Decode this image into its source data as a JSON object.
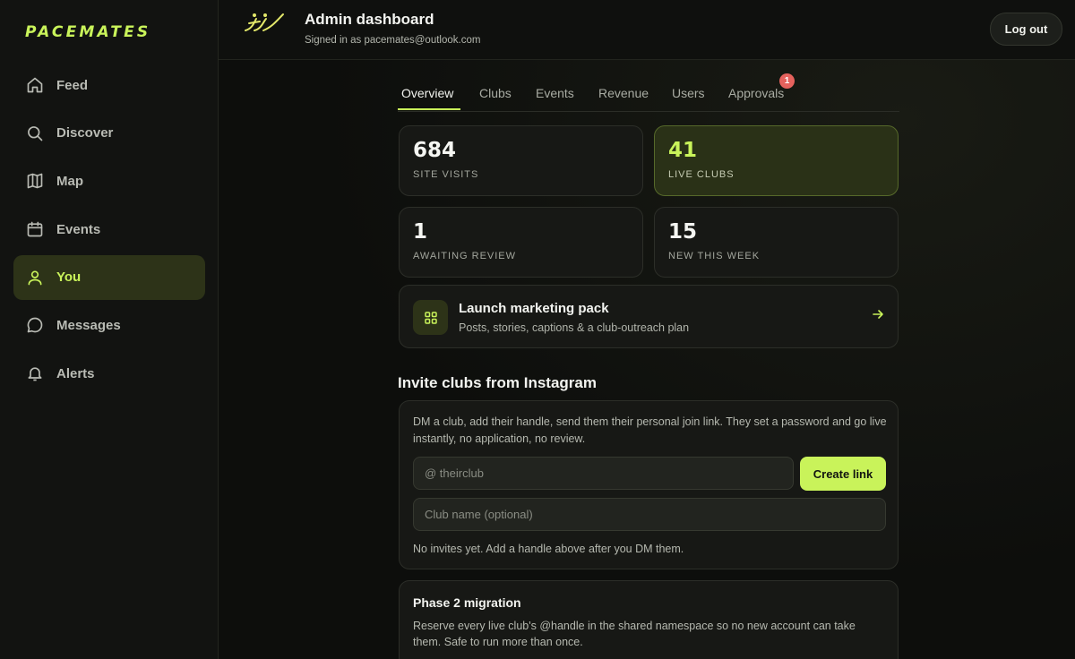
{
  "brand": "PACEMATES",
  "sidebar": {
    "items": [
      {
        "label": "Feed",
        "icon": "home-icon"
      },
      {
        "label": "Discover",
        "icon": "search-icon"
      },
      {
        "label": "Map",
        "icon": "map-icon"
      },
      {
        "label": "Events",
        "icon": "calendar-icon"
      },
      {
        "label": "You",
        "icon": "user-icon",
        "active": true
      },
      {
        "label": "Messages",
        "icon": "chat-icon"
      },
      {
        "label": "Alerts",
        "icon": "bell-icon"
      }
    ]
  },
  "header": {
    "title": "Admin dashboard",
    "subtitle": "Signed in as pacemates@outlook.com",
    "logout_label": "Log out"
  },
  "tabs": {
    "items": [
      "Overview",
      "Clubs",
      "Events",
      "Revenue",
      "Users",
      "Approvals"
    ],
    "active": "Overview",
    "approvals_badge": "1"
  },
  "stats": {
    "site_visits": {
      "value": "684",
      "label": "SITE VISITS"
    },
    "live_clubs": {
      "value": "41",
      "label": "LIVE CLUBS"
    },
    "awaiting_review": {
      "value": "1",
      "label": "AWAITING REVIEW"
    },
    "new_this_week": {
      "value": "15",
      "label": "NEW THIS WEEK"
    }
  },
  "marketing": {
    "title": "Launch marketing pack",
    "subtitle": "Posts, stories, captions & a club-outreach plan"
  },
  "invite": {
    "section_title": "Invite clubs from Instagram",
    "description": "DM a club, add their handle, send them their personal join link. They set a password and go live instantly, no application, no review.",
    "handle_placeholder": "@ theirclub",
    "club_name_placeholder": "Club name (optional)",
    "create_label": "Create link",
    "empty_text": "No invites yet. Add a handle above after you DM them."
  },
  "migration": {
    "title": "Phase 2 migration",
    "description": "Reserve every live club's @handle in the shared namespace so no new account can take them. Safe to run more than once."
  },
  "colors": {
    "accent": "#c9f35a",
    "background": "#0d0e0c",
    "badge": "#e5625d"
  }
}
